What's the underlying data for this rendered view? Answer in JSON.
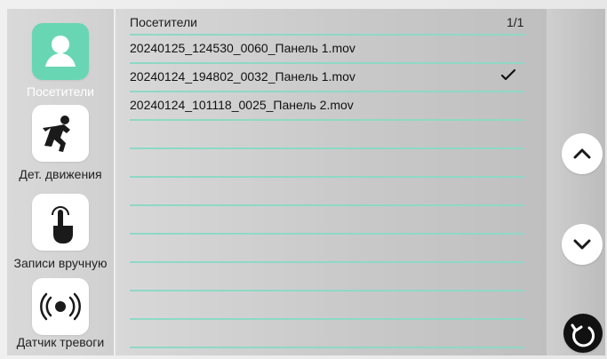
{
  "sidebar": {
    "items": [
      {
        "label": "Посетители",
        "icon": "user-icon",
        "active": true
      },
      {
        "label": "Дет. движения",
        "icon": "running-person-icon",
        "active": false
      },
      {
        "label": "Записи вручную",
        "icon": "hand-touch-icon",
        "active": false
      },
      {
        "label": "Датчик тревоги",
        "icon": "alarm-signal-icon",
        "active": false
      }
    ]
  },
  "list": {
    "title": "Посетители",
    "page": "1/1",
    "rows": [
      {
        "name": "20240125_124530_0060_Панель 1.mov",
        "checked": false
      },
      {
        "name": "20240124_194802_0032_Панель 1.mov",
        "checked": true
      },
      {
        "name": "20240124_101118_0025_Панель 2.mov",
        "checked": false
      },
      {
        "name": "",
        "checked": false
      },
      {
        "name": "",
        "checked": false
      },
      {
        "name": "",
        "checked": false
      },
      {
        "name": "",
        "checked": false
      },
      {
        "name": "",
        "checked": false
      },
      {
        "name": "",
        "checked": false
      },
      {
        "name": "",
        "checked": false
      },
      {
        "name": "",
        "checked": false
      }
    ]
  },
  "controls": {
    "up_icon": "chevron-up-icon",
    "down_icon": "chevron-down-icon",
    "back_icon": "return-icon"
  },
  "colors": {
    "accent": "#69d6b3",
    "row_line": "#8ed9c4"
  }
}
